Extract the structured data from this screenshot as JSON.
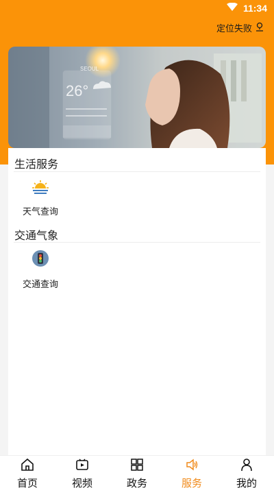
{
  "status": {
    "time": "11:34"
  },
  "location": {
    "label": "定位失败"
  },
  "banner": {
    "weather_city": "SEOUL",
    "weather_temp": "26°"
  },
  "sections": [
    {
      "title": "生活服务",
      "items": [
        {
          "label": "天气查询",
          "icon": "weather-sun-icon"
        }
      ]
    },
    {
      "title": "交通气象",
      "items": [
        {
          "label": "交通查询",
          "icon": "traffic-light-icon"
        }
      ]
    }
  ],
  "tabs": [
    {
      "label": "首页",
      "icon": "home-icon"
    },
    {
      "label": "视频",
      "icon": "video-icon"
    },
    {
      "label": "政务",
      "icon": "grid-icon"
    },
    {
      "label": "服务",
      "icon": "speaker-icon",
      "active": true
    },
    {
      "label": "我的",
      "icon": "user-icon"
    }
  ],
  "colors": {
    "accent": "#fb9308",
    "active_tab": "#f08a1a"
  }
}
